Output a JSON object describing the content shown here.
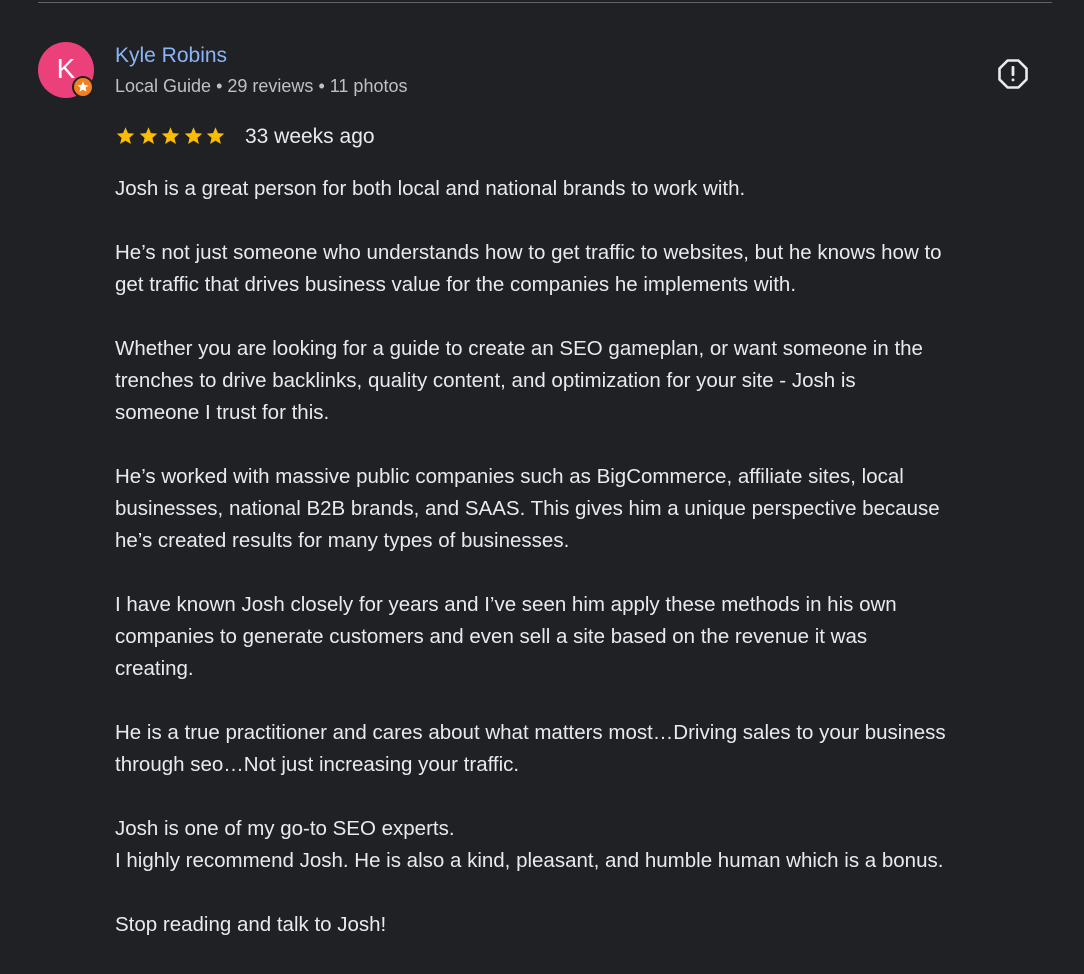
{
  "review": {
    "avatar_letter": "K",
    "reviewer_name": "Kyle Robins",
    "reviewer_status": "Local Guide",
    "reviews_count": "29 reviews",
    "photos_count": "11 photos",
    "separator": "•",
    "rating": 5,
    "time_ago": "33 weeks ago",
    "paragraphs": [
      [
        "Josh is a great person for both local and national brands to work with."
      ],
      [
        "He’s not just someone who understands how to get traffic to websites, but he knows how to",
        "get traffic that drives business value for the companies he implements with."
      ],
      [
        "Whether you are looking for a guide to create an SEO gameplan, or want someone in the",
        "trenches to drive backlinks, quality content, and optimization for your site - Josh is",
        "someone I trust for this."
      ],
      [
        "He’s worked with massive public companies such as BigCommerce, affiliate sites, local",
        "businesses, national B2B brands, and SAAS. This gives him a unique perspective because",
        "he’s created results for many types of businesses."
      ],
      [
        "I have known Josh closely for years and I’ve seen him apply these methods in his own",
        "companies to generate customers and even sell a site based on the revenue it was",
        "creating."
      ],
      [
        "He is a true practitioner and cares about what matters most…Driving sales to your business",
        "through seo…Not just increasing your traffic."
      ],
      [
        "Josh is one of my go-to SEO experts.",
        "I highly recommend Josh. He is also a kind, pleasant, and humble human which is a bonus."
      ],
      [
        "Stop reading and talk to Josh!"
      ]
    ]
  },
  "icons": {
    "report": "report-flag-icon",
    "badge": "local-guide-star-icon",
    "star": "star-icon"
  },
  "colors": {
    "background": "#202124",
    "avatar": "#ec407a",
    "badge": "#f3801f",
    "name": "#8ab4f8",
    "star": "#fbbc04",
    "text": "#e8eaed",
    "meta": "#bdc1c6"
  }
}
